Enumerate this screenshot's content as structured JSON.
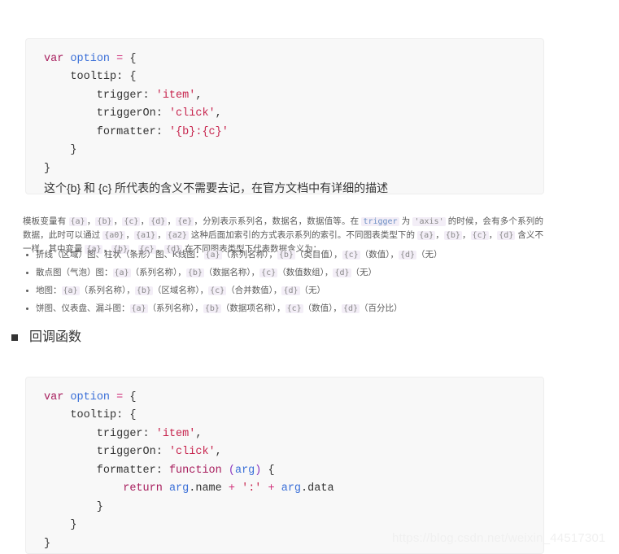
{
  "code_block_1": {
    "lines": [
      [
        {
          "t": "var",
          "c": "kw"
        },
        {
          "t": " ",
          "c": "plain"
        },
        {
          "t": "option",
          "c": "var"
        },
        {
          "t": " ",
          "c": "plain"
        },
        {
          "t": "=",
          "c": "op"
        },
        {
          "t": " {",
          "c": "punc"
        }
      ],
      [
        {
          "t": "    tooltip",
          "c": "plain"
        },
        {
          "t": ": {",
          "c": "punc"
        }
      ],
      [
        {
          "t": "        trigger",
          "c": "plain"
        },
        {
          "t": ": ",
          "c": "punc"
        },
        {
          "t": "'item'",
          "c": "str"
        },
        {
          "t": ",",
          "c": "punc"
        }
      ],
      [
        {
          "t": "        triggerOn",
          "c": "plain"
        },
        {
          "t": ": ",
          "c": "punc"
        },
        {
          "t": "'click'",
          "c": "str"
        },
        {
          "t": ",",
          "c": "punc"
        }
      ],
      [
        {
          "t": "        formatter",
          "c": "plain"
        },
        {
          "t": ": ",
          "c": "punc"
        },
        {
          "t": "'{b}:{c}'",
          "c": "str"
        }
      ],
      [
        {
          "t": "    }",
          "c": "punc"
        }
      ],
      [
        {
          "t": "}",
          "c": "punc"
        }
      ]
    ],
    "note": "这个{b} 和 {c} 所代表的含义不需要去记，在官方文档中有详细的描述"
  },
  "paragraph": {
    "segments": [
      {
        "t": "模板变量有 ",
        "k": "text"
      },
      {
        "t": "{a}",
        "k": "code"
      },
      {
        "t": "，",
        "k": "text"
      },
      {
        "t": "{b}",
        "k": "code"
      },
      {
        "t": "，",
        "k": "text"
      },
      {
        "t": "{c}",
        "k": "code"
      },
      {
        "t": "，",
        "k": "text"
      },
      {
        "t": "{d}",
        "k": "code"
      },
      {
        "t": "，",
        "k": "text"
      },
      {
        "t": "{e}",
        "k": "code"
      },
      {
        "t": "，分别表示系列名，数据名，数据值等。在 ",
        "k": "text"
      },
      {
        "t": "trigger",
        "k": "code-kw"
      },
      {
        "t": " 为 ",
        "k": "text"
      },
      {
        "t": "'axis'",
        "k": "code"
      },
      {
        "t": " 的时候，会有多个系列的数据，此时可以通过 ",
        "k": "text"
      },
      {
        "t": "{a0}",
        "k": "code"
      },
      {
        "t": "，",
        "k": "text"
      },
      {
        "t": "{a1}",
        "k": "code"
      },
      {
        "t": "，",
        "k": "text"
      },
      {
        "t": "{a2}",
        "k": "code"
      },
      {
        "t": " 这种后面加索引的方式表示系列的索引。不同图表类型下的 ",
        "k": "text"
      },
      {
        "t": "{a}",
        "k": "code"
      },
      {
        "t": "，",
        "k": "text"
      },
      {
        "t": "{b}",
        "k": "code"
      },
      {
        "t": "，",
        "k": "text"
      },
      {
        "t": "{c}",
        "k": "code"
      },
      {
        "t": "，",
        "k": "text"
      },
      {
        "t": "{d}",
        "k": "code"
      },
      {
        "t": " 含义不一样。其中变量 ",
        "k": "text"
      },
      {
        "t": "{a}",
        "k": "code"
      },
      {
        "t": "，",
        "k": "text"
      },
      {
        "t": "{b}",
        "k": "code"
      },
      {
        "t": "，",
        "k": "text"
      },
      {
        "t": "{c}",
        "k": "code"
      },
      {
        "t": "，",
        "k": "text"
      },
      {
        "t": "{d}",
        "k": "code"
      },
      {
        "t": " 在不同图表类型下代表数据含义为：",
        "k": "text"
      }
    ]
  },
  "bullets": [
    {
      "segments": [
        {
          "t": "折线（区域）图、柱状（条形）图、K线图：",
          "k": "text"
        },
        {
          "t": "{a}",
          "k": "code"
        },
        {
          "t": "（系列名称），",
          "k": "text"
        },
        {
          "t": "{b}",
          "k": "code"
        },
        {
          "t": "（类目值），",
          "k": "text"
        },
        {
          "t": "{c}",
          "k": "code"
        },
        {
          "t": "（数值），",
          "k": "text"
        },
        {
          "t": "{d}",
          "k": "code"
        },
        {
          "t": "（无）",
          "k": "text"
        }
      ]
    },
    {
      "segments": [
        {
          "t": "散点图（气泡）图：",
          "k": "text"
        },
        {
          "t": "{a}",
          "k": "code"
        },
        {
          "t": "（系列名称），",
          "k": "text"
        },
        {
          "t": "{b}",
          "k": "code"
        },
        {
          "t": "（数据名称），",
          "k": "text"
        },
        {
          "t": "{c}",
          "k": "code"
        },
        {
          "t": "（数值数组），",
          "k": "text"
        },
        {
          "t": "{d}",
          "k": "code"
        },
        {
          "t": "（无）",
          "k": "text"
        }
      ]
    },
    {
      "segments": [
        {
          "t": "地图：",
          "k": "text"
        },
        {
          "t": "{a}",
          "k": "code"
        },
        {
          "t": "（系列名称），",
          "k": "text"
        },
        {
          "t": "{b}",
          "k": "code"
        },
        {
          "t": "（区域名称），",
          "k": "text"
        },
        {
          "t": "{c}",
          "k": "code"
        },
        {
          "t": "（合并数值），",
          "k": "text"
        },
        {
          "t": "{d}",
          "k": "code"
        },
        {
          "t": "（无）",
          "k": "text"
        }
      ]
    },
    {
      "segments": [
        {
          "t": "饼图、仪表盘、漏斗图：",
          "k": "text"
        },
        {
          "t": "{a}",
          "k": "code"
        },
        {
          "t": "（系列名称），",
          "k": "text"
        },
        {
          "t": "{b}",
          "k": "code"
        },
        {
          "t": "（数据项名称），",
          "k": "text"
        },
        {
          "t": "{c}",
          "k": "code"
        },
        {
          "t": "（数值），",
          "k": "text"
        },
        {
          "t": "{d}",
          "k": "code"
        },
        {
          "t": "（百分比）",
          "k": "text"
        }
      ]
    }
  ],
  "section_heading": {
    "text": "回调函数"
  },
  "code_block_2": {
    "lines": [
      [
        {
          "t": "var",
          "c": "kw"
        },
        {
          "t": " ",
          "c": "plain"
        },
        {
          "t": "option",
          "c": "var"
        },
        {
          "t": " ",
          "c": "plain"
        },
        {
          "t": "=",
          "c": "op"
        },
        {
          "t": " {",
          "c": "punc"
        }
      ],
      [
        {
          "t": "    tooltip",
          "c": "plain"
        },
        {
          "t": ": {",
          "c": "punc"
        }
      ],
      [
        {
          "t": "        trigger",
          "c": "plain"
        },
        {
          "t": ": ",
          "c": "punc"
        },
        {
          "t": "'item'",
          "c": "str"
        },
        {
          "t": ",",
          "c": "punc"
        }
      ],
      [
        {
          "t": "        triggerOn",
          "c": "plain"
        },
        {
          "t": ": ",
          "c": "punc"
        },
        {
          "t": "'click'",
          "c": "str"
        },
        {
          "t": ",",
          "c": "punc"
        }
      ],
      [
        {
          "t": "        formatter",
          "c": "plain"
        },
        {
          "t": ": ",
          "c": "punc"
        },
        {
          "t": "function",
          "c": "kw"
        },
        {
          "t": " ",
          "c": "plain"
        },
        {
          "t": "(",
          "c": "paren"
        },
        {
          "t": "arg",
          "c": "var"
        },
        {
          "t": ")",
          "c": "paren"
        },
        {
          "t": " {",
          "c": "punc"
        }
      ],
      [
        {
          "t": "            ",
          "c": "plain"
        },
        {
          "t": "return",
          "c": "kw"
        },
        {
          "t": " ",
          "c": "plain"
        },
        {
          "t": "arg",
          "c": "var"
        },
        {
          "t": ".name",
          "c": "plain"
        },
        {
          "t": " ",
          "c": "plain"
        },
        {
          "t": "+",
          "c": "op"
        },
        {
          "t": " ",
          "c": "plain"
        },
        {
          "t": "':'",
          "c": "str"
        },
        {
          "t": " ",
          "c": "plain"
        },
        {
          "t": "+",
          "c": "op"
        },
        {
          "t": " ",
          "c": "plain"
        },
        {
          "t": "arg",
          "c": "var"
        },
        {
          "t": ".data",
          "c": "plain"
        }
      ],
      [
        {
          "t": "        }",
          "c": "punc"
        }
      ],
      [
        {
          "t": "    }",
          "c": "punc"
        }
      ],
      [
        {
          "t": "}",
          "c": "punc"
        }
      ]
    ]
  },
  "watermark": {
    "text": "https://blog.csdn.net/weixin_44517301"
  },
  "colors": {
    "code_background": "#f8f8f8",
    "code_border": "#eeeeee",
    "keyword": "#a71d5d",
    "identifier": "#3a6fd8",
    "string": "#c7254e",
    "operator": "#d0307a",
    "paren": "#8b35bd",
    "inline_code_background": "#f3eef7",
    "body_text": "#5a5a5a",
    "heading_text": "#333333",
    "watermark": "#f0f0f0"
  }
}
